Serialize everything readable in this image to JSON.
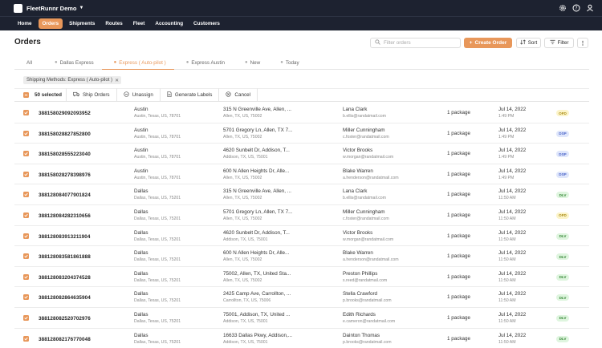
{
  "app": {
    "brand": "FleetRunnr Demo"
  },
  "nav": [
    "Home",
    "Orders",
    "Shipments",
    "Routes",
    "Fleet",
    "Accounting",
    "Customers"
  ],
  "nav_active": "Orders",
  "page": {
    "title": "Orders"
  },
  "toolbar": {
    "search_placeholder": "Filter orders",
    "create_label": "Create Order",
    "sort_label": "Sort",
    "filter_label": "Filter"
  },
  "tabs": [
    {
      "label": "All",
      "active": false,
      "dot": false
    },
    {
      "label": "Dallas Express",
      "active": false,
      "dot": true
    },
    {
      "label": "Express ( Auto-pilot )",
      "active": true,
      "dot": true
    },
    {
      "label": "Express Austin",
      "active": false,
      "dot": true
    },
    {
      "label": "New",
      "active": false,
      "dot": true
    },
    {
      "label": "Today",
      "active": false,
      "dot": true
    }
  ],
  "filter_chip": {
    "label": "Shipping Methods: Express ( Auto-pilot )"
  },
  "bulk": {
    "selected_label": "50 selected",
    "ship_label": "Ship Orders",
    "unassign_label": "Unassign",
    "labels_label": "Generate Labels",
    "cancel_label": "Cancel"
  },
  "colors": {
    "accent": "#e8975a",
    "topbar": "#1d2230"
  },
  "orders": [
    {
      "id": "388158029092093952",
      "city": "Austin",
      "city_addr": "Austin, Texas, US, 78701",
      "addr": "315 N Greenville Ave, Allen, ...",
      "addr2": "Allen, TX, US, 75002",
      "name": "Lana Clark",
      "email": "b.ellis@randatmail.com",
      "pkg": "1 package",
      "date": "Jul 14, 2022",
      "time": "1:49 PM",
      "status": "OFD"
    },
    {
      "id": "388158028827852800",
      "city": "Austin",
      "city_addr": "Austin, Texas, US, 78701",
      "addr": "5701 Gregory Ln, Allen, TX 7...",
      "addr2": "Allen, TX, US, 75002",
      "name": "Miller Cunningham",
      "email": "c.foster@randatmail.com",
      "pkg": "1 package",
      "date": "Jul 14, 2022",
      "time": "1:49 PM",
      "status": "DSP"
    },
    {
      "id": "388158028555223040",
      "city": "Austin",
      "city_addr": "Austin, Texas, US, 78701",
      "addr": "4620 Sunbelt Dr, Addison, T...",
      "addr2": "Addison, TX, US, 75001",
      "name": "Victor Brooks",
      "email": "w.morgan@randatmail.com",
      "pkg": "1 package",
      "date": "Jul 14, 2022",
      "time": "1:49 PM",
      "status": "DSP"
    },
    {
      "id": "388158028278398976",
      "city": "Austin",
      "city_addr": "Austin, Texas, US, 78701",
      "addr": "600 N Allen Heights Dr, Alle...",
      "addr2": "Allen, TX, US, 75002",
      "name": "Blake Warren",
      "email": "a.henderson@randatmail.com",
      "pkg": "1 package",
      "date": "Jul 14, 2022",
      "time": "1:49 PM",
      "status": "DSP"
    },
    {
      "id": "388128084077901824",
      "city": "Dallas",
      "city_addr": "Dallas, Texas, US, 75201",
      "addr": "315 N Greenville Ave, Allen, ...",
      "addr2": "Allen, TX, US, 75002",
      "name": "Lana Clark",
      "email": "b.ellis@randatmail.com",
      "pkg": "1 package",
      "date": "Jul 14, 2022",
      "time": "11:50 AM",
      "status": "DLV"
    },
    {
      "id": "388128084282310656",
      "city": "Dallas",
      "city_addr": "Dallas, Texas, US, 75201",
      "addr": "5701 Gregory Ln, Allen, TX 7...",
      "addr2": "Allen, TX, US, 75002",
      "name": "Miller Cunningham",
      "email": "c.foster@randatmail.com",
      "pkg": "1 package",
      "date": "Jul 14, 2022",
      "time": "11:50 AM",
      "status": "OFD"
    },
    {
      "id": "388128083913211904",
      "city": "Dallas",
      "city_addr": "Dallas, Texas, US, 75201",
      "addr": "4620 Sunbelt Dr, Addison, T...",
      "addr2": "Addison, TX, US, 75001",
      "name": "Victor Brooks",
      "email": "w.morgan@randatmail.com",
      "pkg": "1 package",
      "date": "Jul 14, 2022",
      "time": "11:50 AM",
      "status": "DLV"
    },
    {
      "id": "388128083581861888",
      "city": "Dallas",
      "city_addr": "Dallas, Texas, US, 75201",
      "addr": "600 N Allen Heights Dr, Alle...",
      "addr2": "Allen, TX, US, 75002",
      "name": "Blake Warren",
      "email": "a.henderson@randatmail.com",
      "pkg": "1 package",
      "date": "Jul 14, 2022",
      "time": "11:50 AM",
      "status": "DLV"
    },
    {
      "id": "388128083204374528",
      "city": "Dallas",
      "city_addr": "Dallas, Texas, US, 75201",
      "addr": "75002, Allen, TX, United Sta...",
      "addr2": "Allen, TX, US, 75002",
      "name": "Preston Phillips",
      "email": "s.reed@randatmail.com",
      "pkg": "1 package",
      "date": "Jul 14, 2022",
      "time": "11:50 AM",
      "status": "DLV"
    },
    {
      "id": "388128082864635904",
      "city": "Dallas",
      "city_addr": "Dallas, Texas, US, 75201",
      "addr": "2425 Camp Ave, Carrollton, ...",
      "addr2": "Carrollton, TX, US, 75006",
      "name": "Stella Crawford",
      "email": "p.brooks@randatmail.com",
      "pkg": "1 package",
      "date": "Jul 14, 2022",
      "time": "11:50 AM",
      "status": "DLV"
    },
    {
      "id": "388128082520702976",
      "city": "Dallas",
      "city_addr": "Dallas, Texas, US, 75201",
      "addr": "75001, Addison, TX, United ...",
      "addr2": "Addison, TX, US, 75001",
      "name": "Edith Richards",
      "email": "e.cameron@randatmail.com",
      "pkg": "1 package",
      "date": "Jul 14, 2022",
      "time": "11:50 AM",
      "status": "DLV"
    },
    {
      "id": "388128082176770048",
      "city": "Dallas",
      "city_addr": "Dallas, Texas, US, 75201",
      "addr": "16633 Dallas Pkwy, Addison,...",
      "addr2": "Addison, TX, US, 75001",
      "name": "Dainton Thomas",
      "email": "p.brooks@randatmail.com",
      "pkg": "1 package",
      "date": "Jul 14, 2022",
      "time": "11:50 AM",
      "status": "DLV"
    }
  ]
}
